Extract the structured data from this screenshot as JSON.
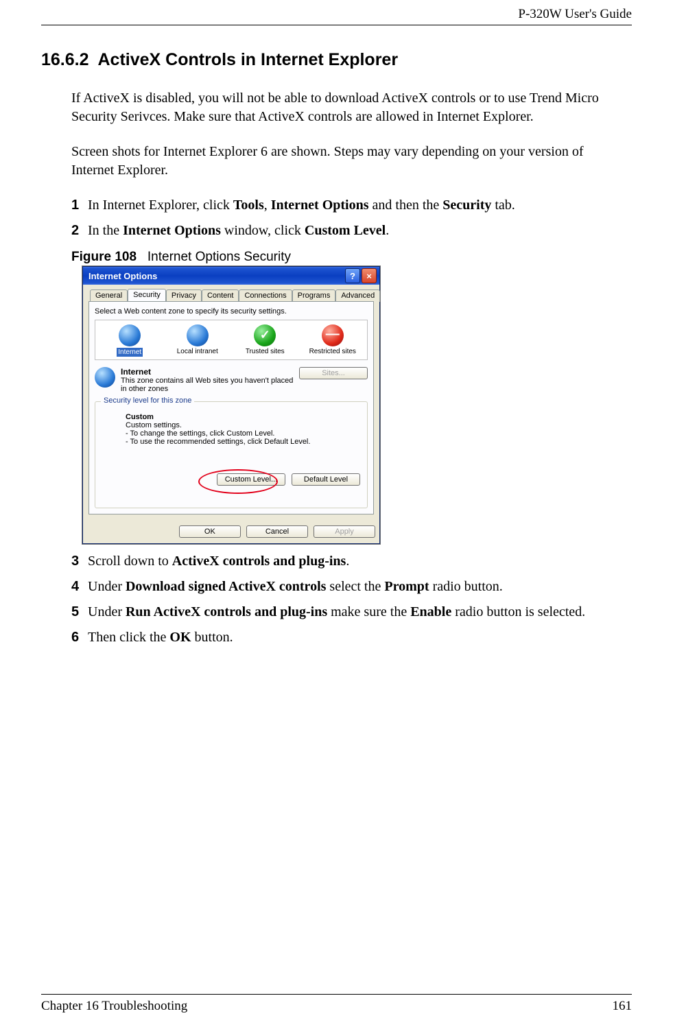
{
  "header": {
    "doc_title": "P-320W User's Guide"
  },
  "footer": {
    "chapter": "Chapter 16 Troubleshooting",
    "page": "161"
  },
  "section": {
    "number": "16.6.2",
    "title": "ActiveX Controls in Internet Explorer"
  },
  "paragraphs": {
    "p1": "If ActiveX is disabled, you will not be able to download ActiveX controls or to use Trend Micro Security Serivces. Make sure that ActiveX controls are allowed in Internet Explorer.",
    "p2": "Screen shots for Internet Explorer 6 are shown. Steps may vary depending on your version of Internet Explorer."
  },
  "steps": {
    "s1_a": "In Internet Explorer, click ",
    "s1_b1": "Tools",
    "s1_c": ", ",
    "s1_b2": "Internet Options",
    "s1_d": " and then the ",
    "s1_b3": "Security",
    "s1_e": " tab.",
    "s2_a": "In the ",
    "s2_b1": "Internet Options",
    "s2_c": " window, click ",
    "s2_b2": "Custom Level",
    "s2_d": ".",
    "s3_a": "Scroll down to ",
    "s3_b1": "ActiveX controls and plug-ins",
    "s3_c": ".",
    "s4_a": "Under ",
    "s4_b1": "Download signed ActiveX controls",
    "s4_c": " select the ",
    "s4_b2": "Prompt",
    "s4_d": " radio button.",
    "s5_a": "Under ",
    "s5_b1": "Run ActiveX controls and plug-ins",
    "s5_c": " make sure the ",
    "s5_b2": "Enable",
    "s5_d": " radio button is selected.",
    "s6_a": "Then click the ",
    "s6_b1": "OK",
    "s6_c": " button."
  },
  "figure": {
    "label": "Figure 108",
    "caption": "Internet Options Security"
  },
  "dialog": {
    "title": "Internet Options",
    "tabs": [
      "General",
      "Security",
      "Privacy",
      "Content",
      "Connections",
      "Programs",
      "Advanced"
    ],
    "active_tab_index": 1,
    "zone_instruction": "Select a Web content zone to specify its security settings.",
    "zones": [
      {
        "label": "Internet",
        "icon": "globe",
        "selected": true
      },
      {
        "label": "Local intranet",
        "icon": "intra",
        "selected": false
      },
      {
        "label": "Trusted sites",
        "icon": "trust",
        "selected": false
      },
      {
        "label": "Restricted sites",
        "icon": "restr",
        "selected": false
      }
    ],
    "zone_detail": {
      "title": "Internet",
      "desc": "This zone contains all Web sites you haven't placed in other zones",
      "sites_btn": "Sites..."
    },
    "fieldset_legend": "Security level for this zone",
    "custom": {
      "title": "Custom",
      "line1": "Custom settings.",
      "line2": "- To change the settings, click Custom Level.",
      "line3": "- To use the recommended settings, click Default Level."
    },
    "custom_level_btn": "Custom Level...",
    "default_level_btn": "Default Level",
    "ok_btn": "OK",
    "cancel_btn": "Cancel",
    "apply_btn": "Apply"
  }
}
